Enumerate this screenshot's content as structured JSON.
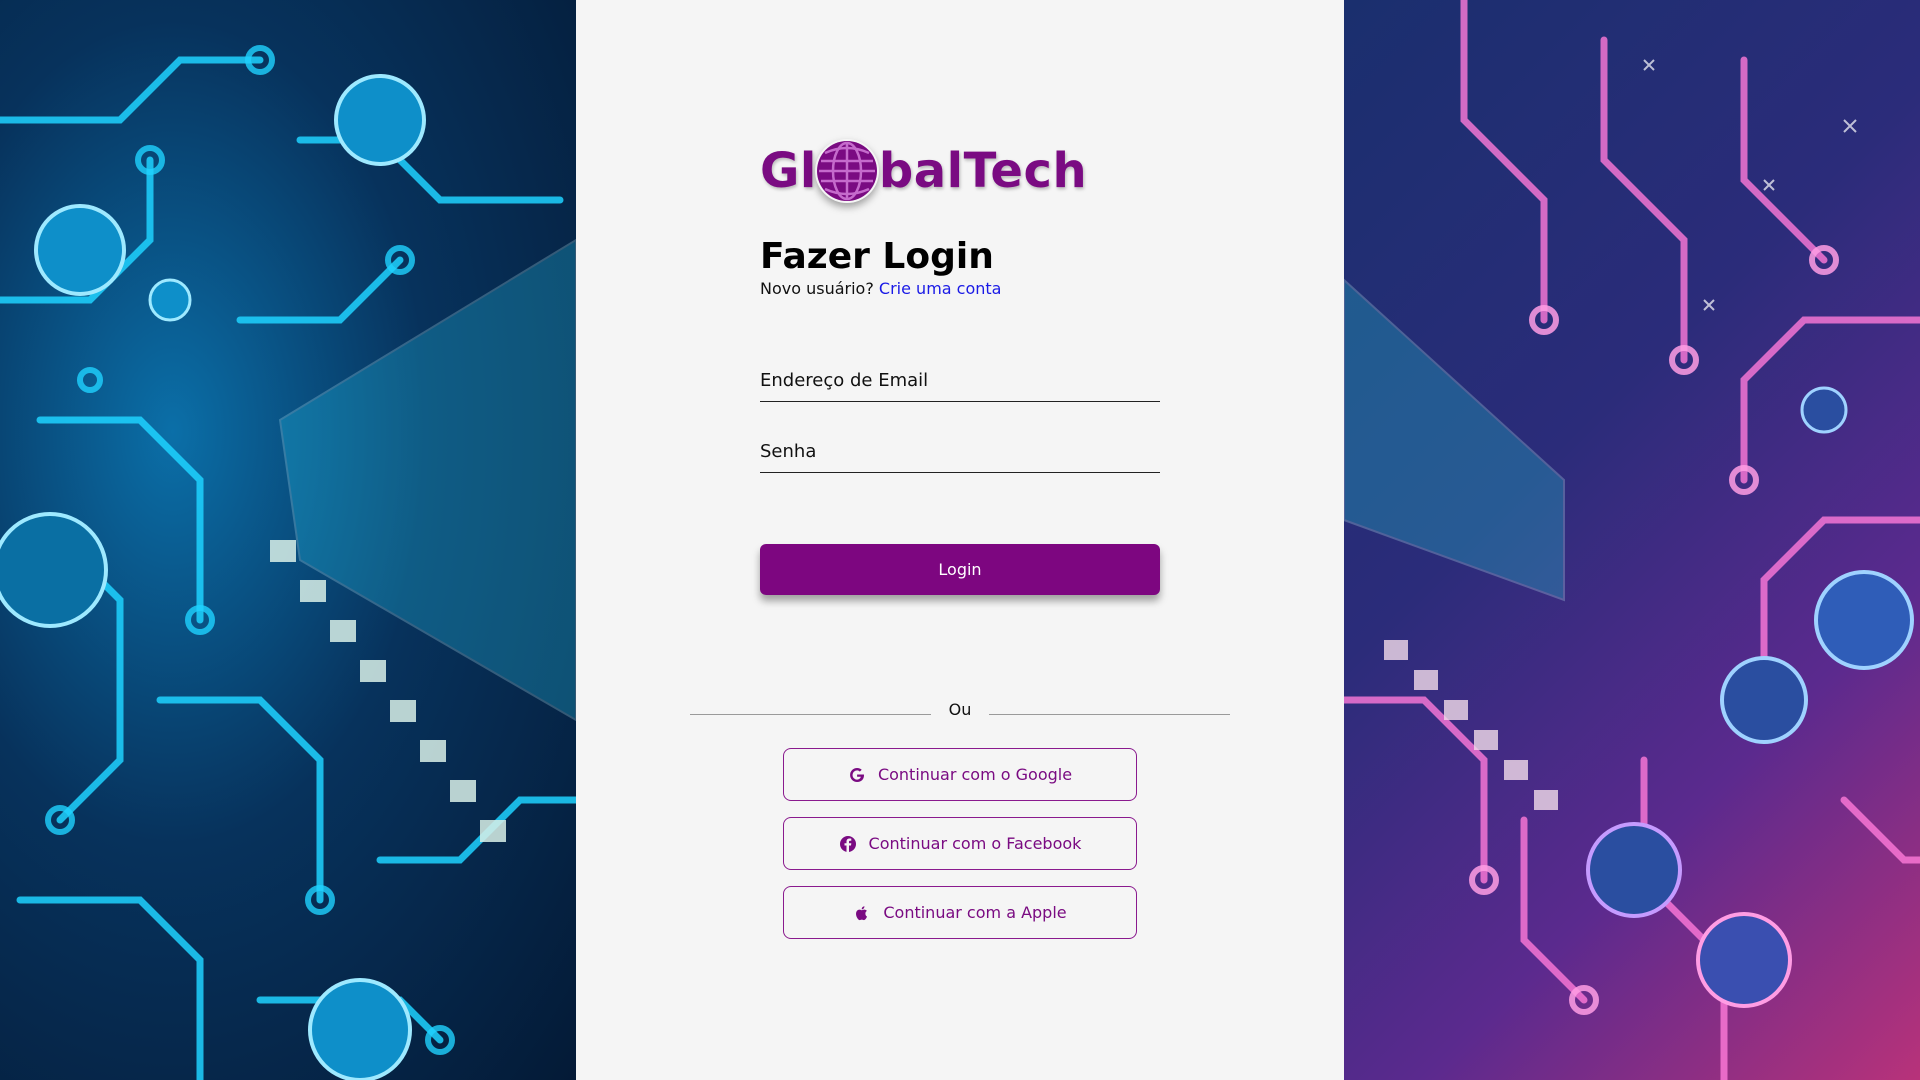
{
  "brand": {
    "prefix": "Gl",
    "suffix": "balTech",
    "color": "#7a0b82"
  },
  "login": {
    "title": "Fazer Login",
    "new_user_text": "Novo usuário?",
    "create_account_link": "Crie uma conta",
    "email_placeholder": "Endereço de Email",
    "password_placeholder": "Senha",
    "submit_label": "Login",
    "divider_text": "Ou"
  },
  "social": {
    "google_label": "Continuar com o Google",
    "facebook_label": "Continuar com o Facebook",
    "apple_label": "Continuar com a Apple"
  },
  "icons": {
    "google": "google-icon",
    "facebook": "facebook-icon",
    "apple": "apple-icon",
    "globe": "globe-icon"
  },
  "colors": {
    "accent": "#7d0680",
    "link": "#1a1ae6",
    "panel_bg": "#f5f5f5"
  }
}
